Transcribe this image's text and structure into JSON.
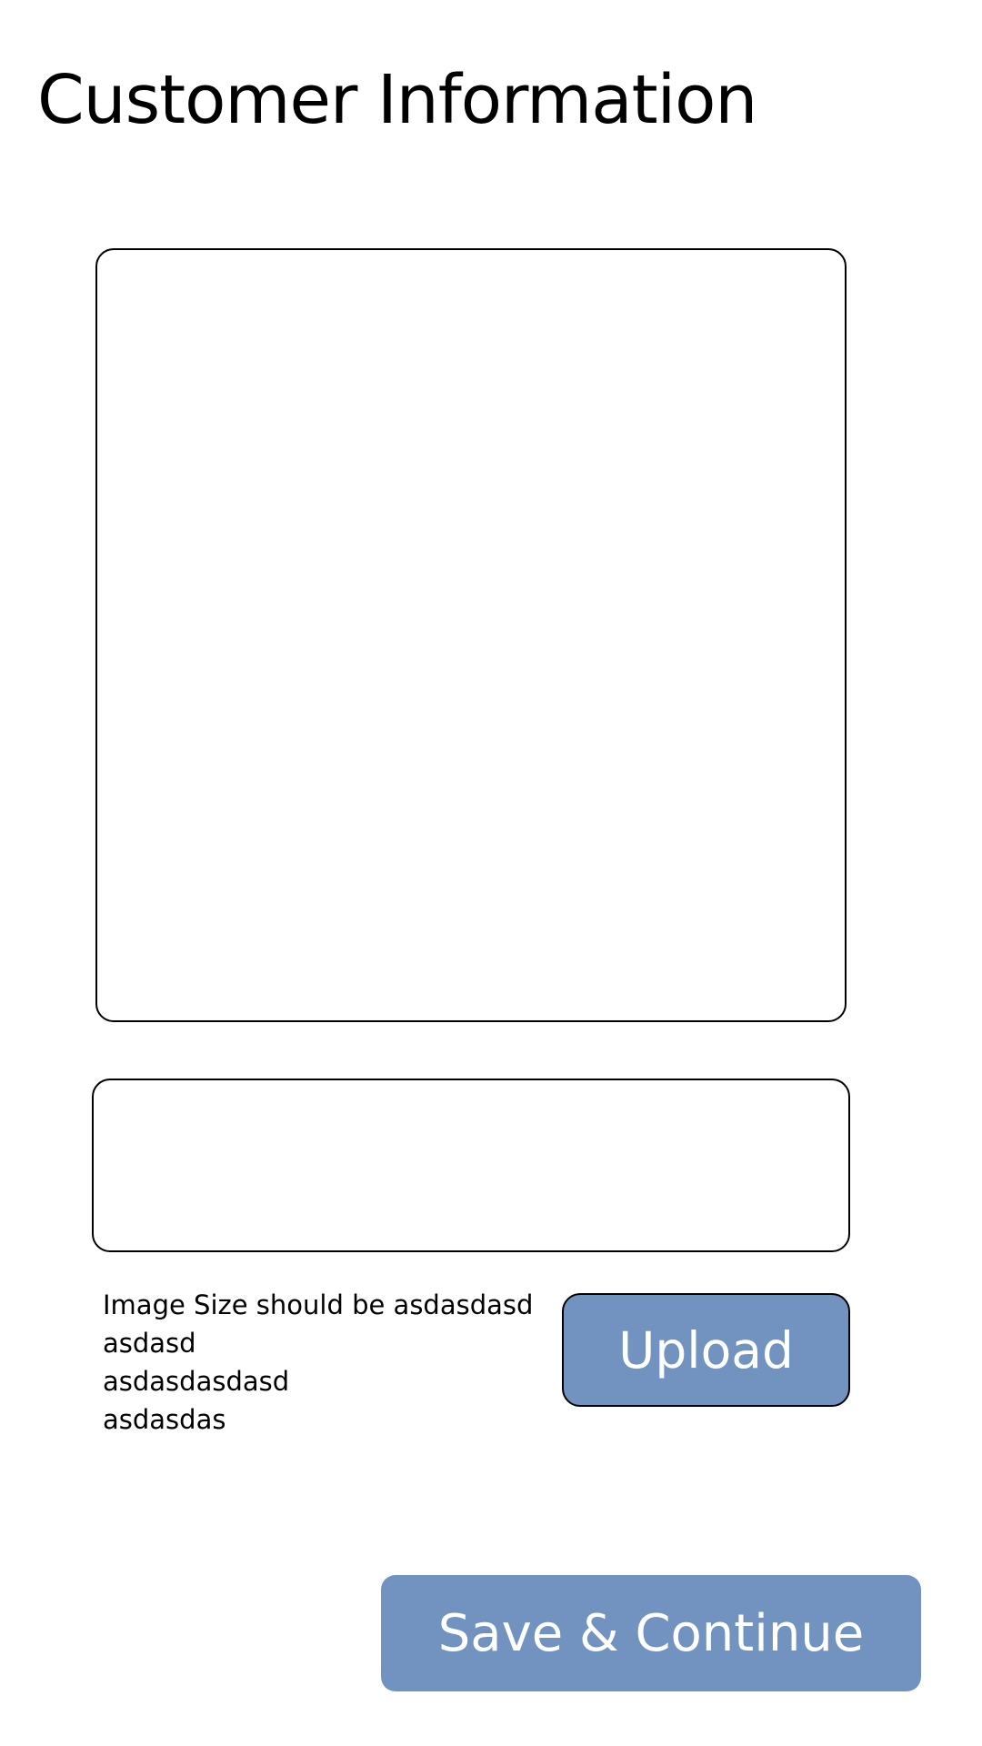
{
  "page": {
    "title": "Customer Information"
  },
  "upload": {
    "hint_lines": [
      "Image Size should be asdasdasd",
      "asdasd",
      "asdasdasdasd",
      "asdasdas"
    ],
    "upload_label": "Upload"
  },
  "actions": {
    "save_label": "Save & Continue"
  },
  "colors": {
    "button_fill": "#7293bf",
    "button_text": "#ffffff",
    "border": "#000000",
    "background": "#ffffff"
  }
}
